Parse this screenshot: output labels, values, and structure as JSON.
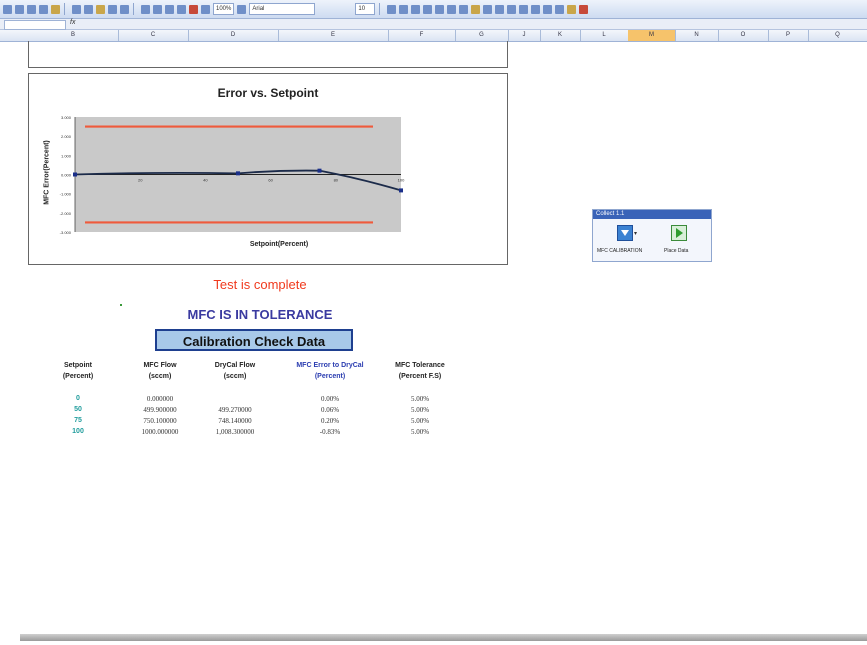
{
  "toolbar": {
    "zoom": "100%",
    "font_name": "Arial",
    "font_size": "10"
  },
  "formula_bar": {
    "name_box": "",
    "fx": "fx"
  },
  "columns": [
    "B",
    "C",
    "D",
    "E",
    "F",
    "G",
    "J",
    "K",
    "L",
    "M",
    "N",
    "O",
    "P",
    "Q"
  ],
  "active_column": "M",
  "chart": {
    "title": "Error vs. Setpoint",
    "ylabel": "MFC Error(Percent)",
    "xlabel": "Setpoint(Percent)",
    "tick_labels_y": [
      "3.000",
      "2.000",
      "1.000",
      "0.000",
      "-1.000",
      "-2.000",
      "-3.000"
    ],
    "tick_labels_x": [
      "20",
      "40",
      "60",
      "80",
      "100"
    ]
  },
  "chart_data": {
    "type": "line",
    "title": "Error vs. Setpoint",
    "xlabel": "Setpoint(Percent)",
    "ylabel": "MFC Error(Percent)",
    "xlim": [
      0,
      100
    ],
    "ylim": [
      -3,
      3
    ],
    "series": [
      {
        "x": [
          0,
          50,
          75,
          100
        ],
        "values": [
          0.0,
          0.06,
          0.2,
          -0.83
        ]
      }
    ],
    "limit_lines": [
      2.5,
      -2.5
    ],
    "colors": {
      "curve": "#1c2b4a",
      "limits": "#ef5a3c",
      "plot_bg": "#c9c9c9"
    }
  },
  "status": {
    "test_complete": "Test is complete",
    "tolerance": "MFC IS IN TOLERANCE",
    "cal_check": "Calibration Check Data"
  },
  "table": {
    "headers": [
      [
        "Setpoint",
        "(Percent)"
      ],
      [
        "MFC Flow",
        "(sccm)"
      ],
      [
        "DryCal Flow",
        "(sccm)"
      ],
      [
        "MFC Error to DryCal",
        "(Percent)"
      ],
      [
        "MFC Tolerance",
        "(Percent F.S)"
      ]
    ],
    "rows": [
      [
        "0",
        "0.000000",
        "",
        "0.00%",
        "5.00%"
      ],
      [
        "50",
        "499.900000",
        "499.270000",
        "0.06%",
        "5.00%"
      ],
      [
        "75",
        "750.100000",
        "748.140000",
        "0.20%",
        "5.00%"
      ],
      [
        "100",
        "1000.000000",
        "1,008.300000",
        "-0.83%",
        "5.00%"
      ]
    ]
  },
  "floating_toolbar": {
    "title": "Collect 1.1",
    "btn1_label": "MFC CALIBRATION",
    "btn2_label": "Place Data"
  }
}
